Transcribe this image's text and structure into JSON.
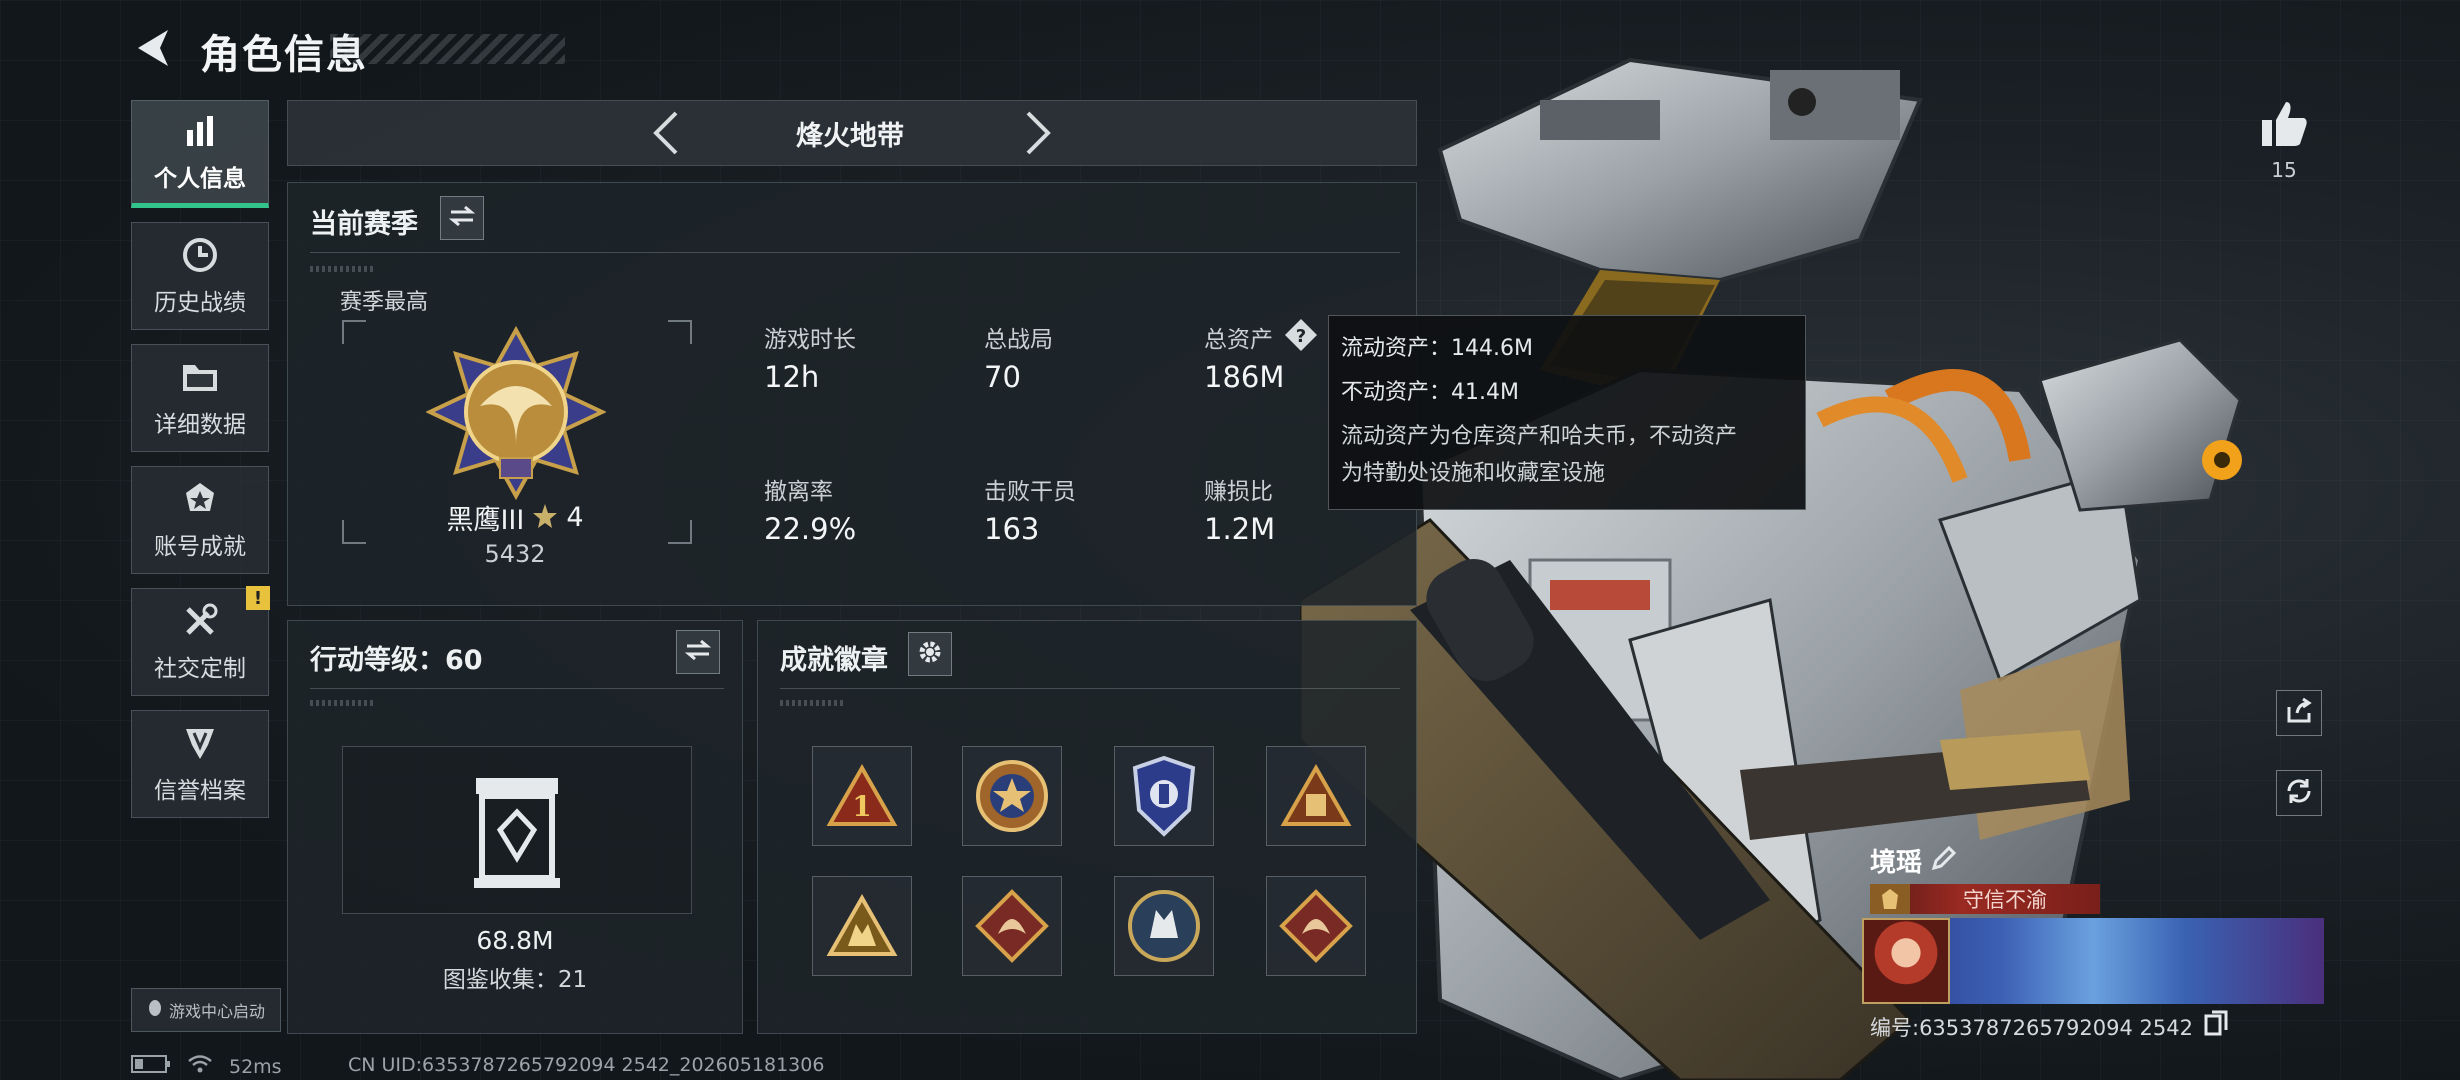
{
  "header": {
    "title": "角色信息"
  },
  "sidebar": {
    "items": [
      {
        "label": "个人信息",
        "icon": "bar-chart-icon",
        "active": true
      },
      {
        "label": "历史战绩",
        "icon": "clock-badge-icon",
        "active": false
      },
      {
        "label": "详细数据",
        "icon": "folder-icon",
        "active": false
      },
      {
        "label": "账号成就",
        "icon": "achievement-icon",
        "active": false
      },
      {
        "label": "社交定制",
        "icon": "tools-icon",
        "active": false,
        "badge": "!"
      },
      {
        "label": "信誉档案",
        "icon": "credit-shield-icon",
        "active": false
      }
    ],
    "launch_label": "游戏中心启动"
  },
  "tabs": {
    "current": "烽火地带"
  },
  "season": {
    "title": "当前赛季",
    "best_label": "赛季最高",
    "rank_name": "黑鹰III",
    "rank_stars": "4",
    "rank_score": "5432",
    "stats": [
      {
        "label": "游戏时长",
        "value": "12h"
      },
      {
        "label": "总战局",
        "value": "70"
      },
      {
        "label": "总资产",
        "value": "186M"
      },
      {
        "label": "撤离率",
        "value": "22.9%"
      },
      {
        "label": "击败干员",
        "value": "163"
      },
      {
        "label": "赚损比",
        "value": "1.2M"
      }
    ]
  },
  "tooltip": {
    "liquid": "流动资产：144.6M",
    "fixed": "不动资产：41.4M",
    "desc_line1": "流动资产为仓库资产和哈夫币，不动资产",
    "desc_line2": "为特勤处设施和收藏室设施"
  },
  "action_level": {
    "title": "行动等级：60",
    "value": "68.8M",
    "collection": "图鉴收集：21"
  },
  "badges": {
    "title": "成就徽章",
    "items": [
      "rank-1-triangle-badge",
      "star-medal-badge",
      "police-shield-badge",
      "supply-triangle-badge",
      "soldiers-triangle-badge",
      "dragon-diamond-badge",
      "wolf-round-badge",
      "dragon-diamond-badge-2"
    ]
  },
  "profile": {
    "likes": "15",
    "name": "境瑶",
    "title": "守信不渝",
    "id_text": "编号:6353787265792094 2542"
  },
  "status": {
    "ping": "52ms",
    "uid": "CN UID:6353787265792094 2542_202605181306"
  },
  "colors": {
    "accent": "#32c48a",
    "warning": "#e8c13d",
    "banner": "#9a2a22"
  }
}
